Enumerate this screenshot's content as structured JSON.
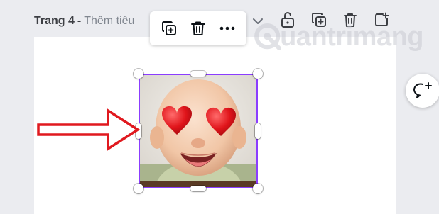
{
  "page_header": {
    "title": "Trang 4",
    "separator": "-",
    "subtitle": "Thêm tiêu"
  },
  "watermark": {
    "text": "uantrimang"
  },
  "colors": {
    "selection": "#8b3dff",
    "annotation_arrow": "#e0191f",
    "canvas_bg": "#ffffff",
    "workspace_bg": "#ebecf0"
  },
  "icons": {
    "header": [
      "chevron-down-icon",
      "unlock-icon",
      "duplicate-page-icon",
      "delete-page-icon",
      "add-page-icon"
    ],
    "toolbar": [
      "duplicate-icon",
      "delete-icon",
      "more-icon"
    ],
    "comment": "add-comment-icon"
  }
}
